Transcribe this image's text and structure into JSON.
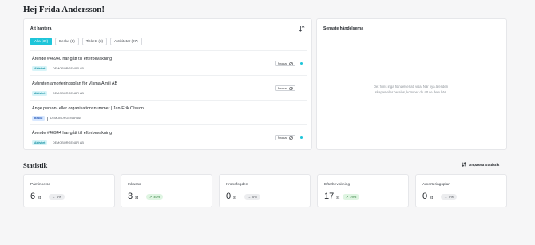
{
  "greeting": "Hej Frida Andersson!",
  "todo": {
    "title": "Att hantera",
    "tabs": [
      {
        "label": "Alla (39)",
        "active": true
      },
      {
        "label": "Beslut (1)",
        "active": false
      },
      {
        "label": "Tickets (3)",
        "active": false
      },
      {
        "label": "Aktiviteter (27)",
        "active": false
      }
    ],
    "items": [
      {
        "title": "Ärende #46940 har gått till efterbevakning",
        "badge": "Aktivitet",
        "company": "DEMOBORGENÄR AB",
        "snooze": "Snooza",
        "unread": true
      },
      {
        "title": "Avbruten amorteringsplan för Visma Amili AB",
        "badge": "Aktivitet",
        "company": "DEMOBORGENÄR AB",
        "snooze": "Snooza",
        "unread": false
      },
      {
        "title": "Ange person- eller organisationsnummer | Jan-Erik Olsson",
        "badge": "Beslut",
        "company": "DEMOBORGENÄR AB",
        "snooze": "",
        "unread": false
      },
      {
        "title": "Ärende #46944 har gått till efterbevakning",
        "badge": "Aktivitet",
        "company": "DEMOBORGENÄR AB",
        "snooze": "Snooza",
        "unread": true
      }
    ]
  },
  "events": {
    "title": "Senaste händelserna",
    "empty_text": "Det finns inga händelser att visa. När nya ärenden skapas eller betalas, kommer du att se dem här."
  },
  "stats": {
    "title": "Statistik",
    "button_label": "Anpassa Statistik",
    "cards": [
      {
        "label": "Påminnelse",
        "value": "6",
        "unit": "st",
        "trend": "0%",
        "direction": "flat"
      },
      {
        "label": "Inkasso",
        "value": "3",
        "unit": "st",
        "trend": "40%",
        "direction": "up"
      },
      {
        "label": "Kronofogden",
        "value": "0",
        "unit": "st",
        "trend": "0%",
        "direction": "flat"
      },
      {
        "label": "Efterbevakning",
        "value": "17",
        "unit": "st",
        "trend": "29%",
        "direction": "up"
      },
      {
        "label": "Amorteringsplan",
        "value": "0",
        "unit": "st",
        "trend": "0%",
        "direction": "flat"
      }
    ]
  },
  "colors": {
    "accent": "#1ec5d9",
    "trend_up": "#2a7a36"
  }
}
